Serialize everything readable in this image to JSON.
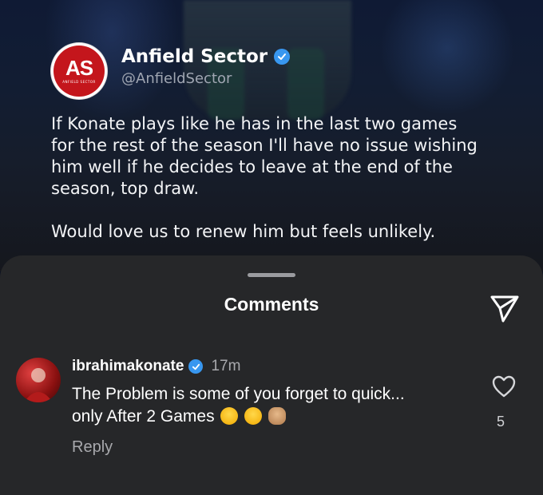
{
  "post": {
    "avatar_letters": "AS",
    "avatar_subtext": "ANFIELD SECTOR",
    "author_name": "Anfield Sector",
    "author_handle": "@AnfieldSector",
    "paragraphs": [
      "If Konate plays like he has in the last two games for the rest of the season I'll have no issue wishing him well if he decides to leave at the end of the season, top draw.",
      "Would love us to renew him but feels unlikely."
    ]
  },
  "sheet": {
    "title": "Comments",
    "share_icon": "send-icon"
  },
  "comment": {
    "username": "ibrahimakonate",
    "time": "17m",
    "text": "The Problem is some of you forget to quick... only After 2 Games",
    "emojis": [
      "face-with-tears-of-joy",
      "face-with-tears-of-joy",
      "clapping-hands"
    ],
    "reply_label": "Reply",
    "like_count": "5",
    "like_icon": "heart-outline-icon"
  },
  "colors": {
    "sheet_bg": "#262729",
    "verified": "#3897f0",
    "brand_red": "#c4161c"
  }
}
